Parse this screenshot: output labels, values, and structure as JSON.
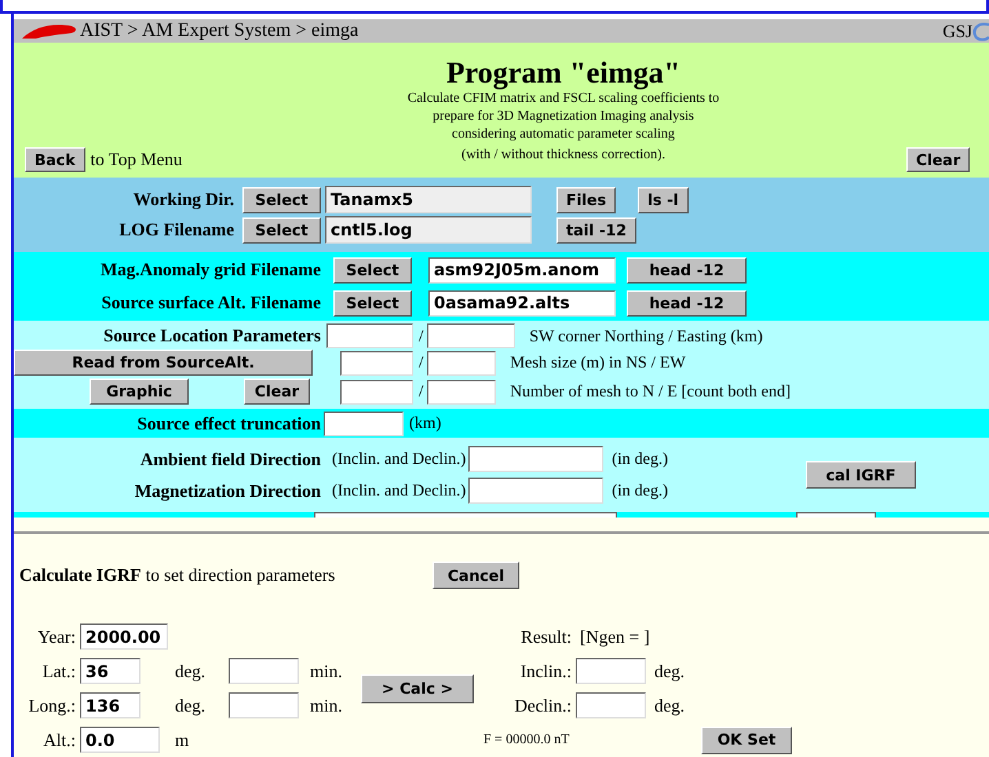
{
  "breadcrumb": "AIST > AM Expert System > eimga",
  "org": "GSJ",
  "header": {
    "title": "Program \"eimga\"",
    "description": [
      "Calculate CFIM matrix and FSCL scaling coefficients to",
      "prepare for 3D Magnetization Imaging analysis",
      "considering automatic parameter scaling"
    ],
    "note": "(with / without thickness correction).",
    "back_button": "Back",
    "back_label": "to Top Menu",
    "clear_button": "Clear"
  },
  "files": [
    {
      "label": "Working Dir.",
      "button": "Select",
      "value": "Tanamx5",
      "actions": [
        "Files",
        "ls -l"
      ]
    },
    {
      "label": "LOG Filename",
      "button": "Select",
      "value": "cntl5.log",
      "actions": [
        "tail -12"
      ]
    }
  ],
  "grids": [
    {
      "label": "Mag.Anomaly grid Filename",
      "button": "Select",
      "value": "asm92J05m.anom",
      "action": "head -12"
    },
    {
      "label": "Source surface Alt. Filename",
      "button": "Select",
      "value": "0asama92.alts",
      "action": "head -12"
    }
  ],
  "source_location": {
    "label": "Source Location Parameters",
    "read_button": "Read from SourceAlt.",
    "graphic_button": "Graphic",
    "clear_button": "Clear",
    "rows": [
      {
        "separator": "/",
        "description": "SW corner Northing / Easting (km)"
      },
      {
        "separator": "/",
        "description": "Mesh size (m) in NS / EW"
      },
      {
        "separator": "/",
        "description": "Number of mesh to N / E [count both end]"
      }
    ]
  },
  "truncation": {
    "label": "Source effect truncation",
    "unit": "(km)"
  },
  "directions": [
    {
      "label": "Ambient field Direction",
      "hint": "(Inclin. and Declin.)",
      "unit": "(in deg.)"
    },
    {
      "label": "Magnetization Direction",
      "hint": "(Inclin. and Declin.)",
      "unit": "(in deg.)"
    }
  ],
  "igrf_button": "cal IGRF",
  "igrf_dialog": {
    "title": "Calculate IGRF",
    "subtitle": "to set direction parameters",
    "cancel_button": "Cancel",
    "year": {
      "label": "Year:",
      "value": "2000.00"
    },
    "coords": [
      {
        "label": "Lat.:",
        "value": "36",
        "unit": "deg.",
        "min_unit": "min."
      },
      {
        "label": "Long.:",
        "value": "136",
        "unit": "deg.",
        "min_unit": "min."
      }
    ],
    "alt": {
      "label": "Alt.:",
      "value": "0.0",
      "unit": "m"
    },
    "calc_button": "> Calc >",
    "result_label": "Result:",
    "ngen": "[Ngen = ]",
    "results": [
      {
        "label": "Inclin.:",
        "unit": "deg."
      },
      {
        "label": "Declin.:",
        "unit": "deg."
      }
    ],
    "f_value": "F = 00000.0 nT",
    "ok_button": "OK Set"
  }
}
